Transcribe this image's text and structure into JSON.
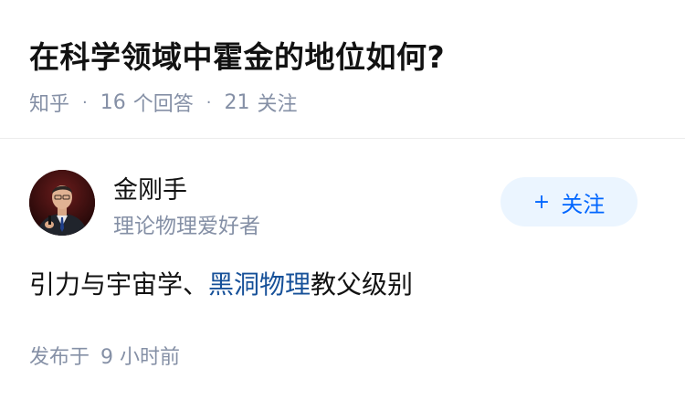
{
  "question": {
    "title": "在科学领域中霍金的地位如何?",
    "source": "知乎",
    "answer_count": "16",
    "answer_label": "个回答",
    "follow_count": "21",
    "follow_label": "关注"
  },
  "author": {
    "name": "金刚手",
    "bio": "理论物理爱好者",
    "avatar_icon": "person-avatar"
  },
  "follow_button": {
    "plus": "+",
    "label": "关注"
  },
  "answer": {
    "text_before": "引力与宇宙学、",
    "link_text": "黑洞物理",
    "text_after": "教父级别"
  },
  "published": {
    "label": "发布于",
    "time": "9 小时前"
  },
  "colors": {
    "accent": "#0066ff",
    "link": "#175199",
    "meta": "#8590a6",
    "button_bg": "#ebf5ff"
  }
}
